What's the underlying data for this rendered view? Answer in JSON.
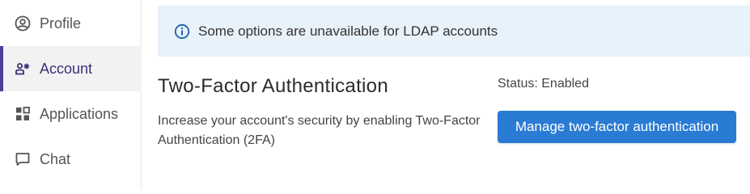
{
  "sidebar": {
    "items": [
      {
        "label": "Profile",
        "icon": "profile-icon",
        "active": false
      },
      {
        "label": "Account",
        "icon": "account-icon",
        "active": true
      },
      {
        "label": "Applications",
        "icon": "applications-icon",
        "active": false
      },
      {
        "label": "Chat",
        "icon": "chat-icon",
        "active": false
      }
    ]
  },
  "banner": {
    "icon": "info-icon",
    "text": "Some options are unavailable for LDAP accounts"
  },
  "two_factor": {
    "title": "Two-Factor Authentication",
    "description": "Increase your account's security by enabling Two-Factor Authentication (2FA)",
    "status": "Status: Enabled",
    "button_label": "Manage two-factor authentication"
  },
  "colors": {
    "accent": "#4a3f9a",
    "button": "#2a7bd4",
    "banner_bg": "#e8f2fb"
  }
}
